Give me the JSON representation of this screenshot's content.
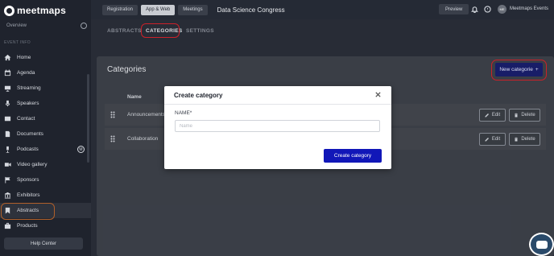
{
  "brand": {
    "logo_text": "meetmaps"
  },
  "sidebar": {
    "partial_item": "Overview",
    "section_label": "EVENT INFO",
    "items": [
      {
        "label": "Home",
        "icon": "home-icon"
      },
      {
        "label": "Agenda",
        "icon": "calendar-icon"
      },
      {
        "label": "Streaming",
        "icon": "streaming-icon"
      },
      {
        "label": "Speakers",
        "icon": "microphone-icon"
      },
      {
        "label": "Contact",
        "icon": "contact-icon"
      },
      {
        "label": "Documents",
        "icon": "document-icon"
      },
      {
        "label": "Podcasts",
        "icon": "podcast-icon",
        "badge": "M"
      },
      {
        "label": "Video gallery",
        "icon": "video-icon"
      },
      {
        "label": "Sponsors",
        "icon": "flag-icon"
      },
      {
        "label": "Exhibitors",
        "icon": "exhibitor-icon"
      },
      {
        "label": "Abstracts",
        "icon": "bookmark-icon",
        "active": true
      },
      {
        "label": "Products",
        "icon": "product-icon"
      }
    ],
    "help_label": "Help Center"
  },
  "topbar": {
    "buttons": [
      {
        "label": "Registration",
        "selected": false
      },
      {
        "label": "App & Web",
        "selected": true
      },
      {
        "label": "Meetings",
        "selected": false
      }
    ],
    "event_title": "Data Science Congress",
    "preview_label": "Preview",
    "user_initials": "ME",
    "user_name": "Meetmaps Events"
  },
  "tabs": [
    {
      "label": "ABSTRACTS",
      "active": false
    },
    {
      "label": "CATEGORIES",
      "active": true
    },
    {
      "label": "SETTINGS",
      "active": false
    }
  ],
  "main": {
    "title": "Categories",
    "new_button_label": "New categorie",
    "new_button_icon": "+",
    "column_name": "Name",
    "rows": [
      {
        "name": "Announcements",
        "edit_label": "Edit",
        "delete_label": "Delete"
      },
      {
        "name": "Collaboration",
        "edit_label": "Edit",
        "delete_label": "Delete"
      }
    ]
  },
  "modal": {
    "title": "Create category",
    "close_icon": "×",
    "field_label": "NAME*",
    "field_placeholder": "Name",
    "field_value": "",
    "submit_label": "Create category"
  },
  "colors": {
    "sidebar_bg": "#1f232d",
    "topbar_bg": "#252a35",
    "primary_button": "#1117b8",
    "highlight_ring": "#d8242c"
  }
}
